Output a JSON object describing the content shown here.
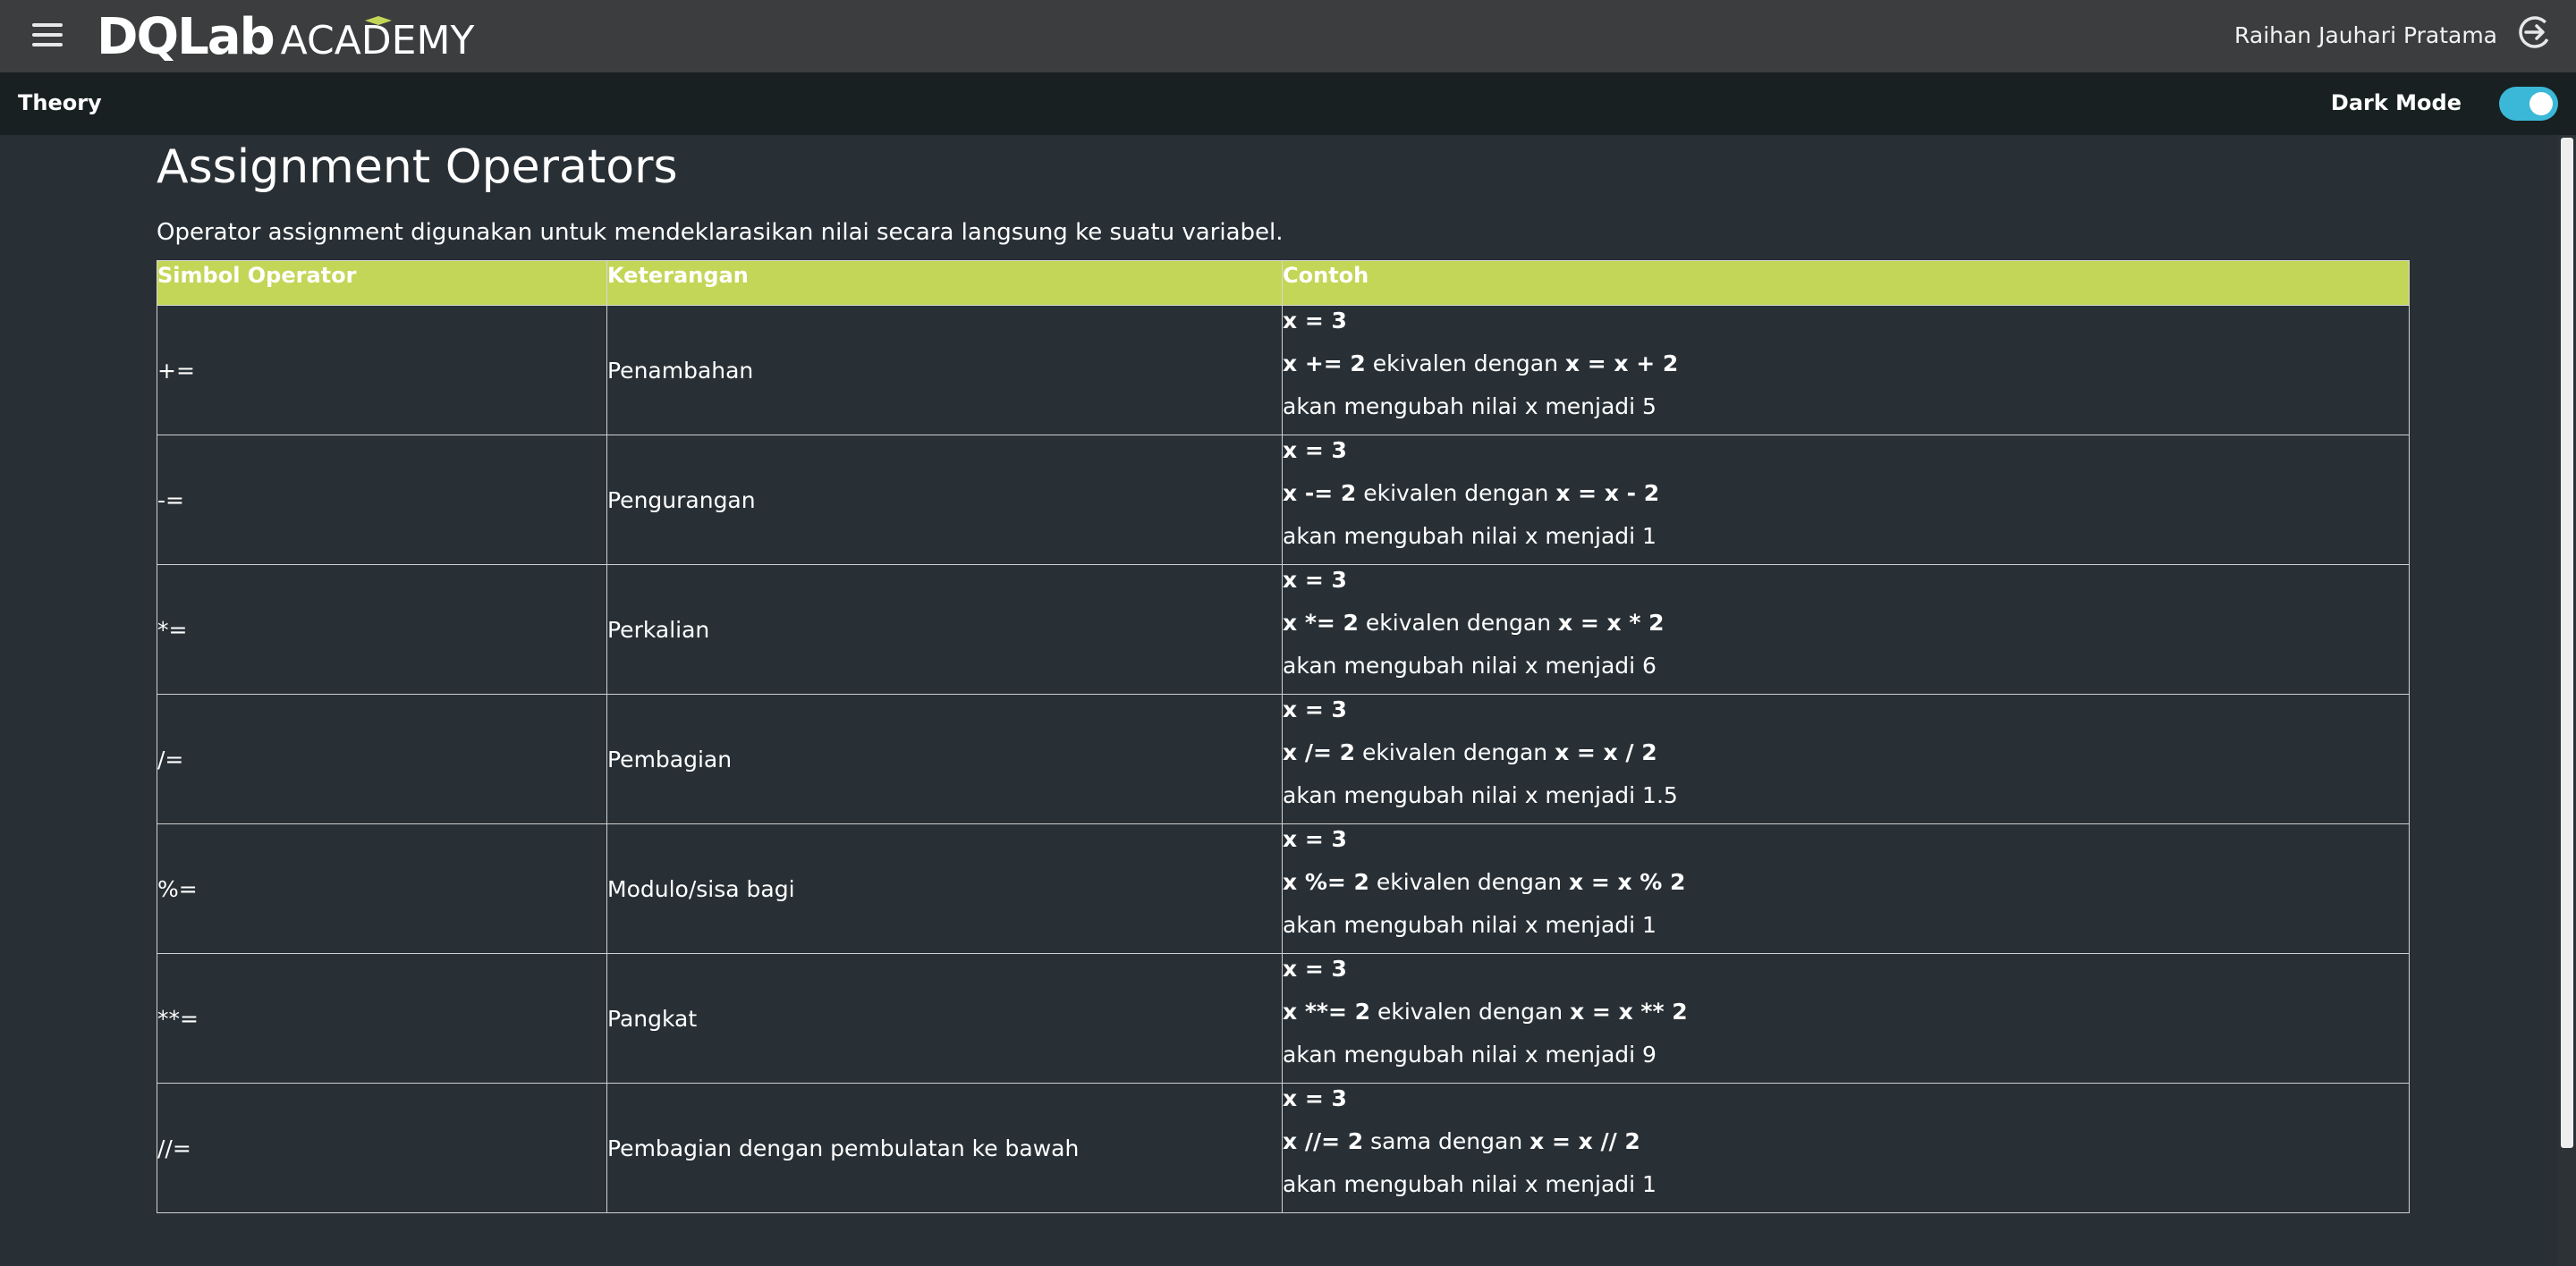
{
  "header": {
    "logo_main": "DQLab",
    "logo_sub": "ACADEMY",
    "user_name": "Raihan Jauhari Pratama"
  },
  "subbar": {
    "title": "Theory",
    "dark_mode_label": "Dark Mode",
    "dark_mode_on": true
  },
  "article": {
    "title": "Assignment Operators",
    "description": "Operator assignment digunakan untuk mendeklarasikan nilai secara langsung ke suatu variabel."
  },
  "table": {
    "headers": [
      "Simbol Operator",
      "Keterangan",
      "Contoh"
    ],
    "rows": [
      {
        "symbol": "+=",
        "desc": "Penambahan",
        "init": "x = 3",
        "op": "x += 2",
        "mid": " ekivalen dengan ",
        "eq": "x = x + 2",
        "result": "akan mengubah nilai x menjadi 5"
      },
      {
        "symbol": "-=",
        "desc": "Pengurangan",
        "init": "x = 3",
        "op": "x -= 2",
        "mid": " ekivalen dengan ",
        "eq": "x = x - 2",
        "result": "akan mengubah nilai x menjadi 1"
      },
      {
        "symbol": "*=",
        "desc": "Perkalian",
        "init": "x = 3",
        "op": "x *= 2",
        "mid": " ekivalen dengan ",
        "eq": "x = x * 2",
        "result": "akan mengubah nilai x menjadi 6"
      },
      {
        "symbol": "/=",
        "desc": "Pembagian",
        "init": "x = 3",
        "op": "x /= 2",
        "mid": " ekivalen dengan ",
        "eq": "x = x / 2",
        "result": "akan mengubah nilai x menjadi 1.5"
      },
      {
        "symbol": "%=",
        "desc": "Modulo/sisa bagi",
        "init": "x = 3",
        "op": "x %= 2",
        "mid": " ekivalen dengan ",
        "eq": "x = x % 2",
        "result": "akan mengubah nilai x menjadi 1"
      },
      {
        "symbol": "**=",
        "desc": "Pangkat",
        "init": "x = 3",
        "op": "x **= 2",
        "mid": " ekivalen dengan ",
        "eq": "x = x ** 2",
        "result": "akan mengubah nilai x menjadi 9"
      },
      {
        "symbol": "//=",
        "desc": "Pembagian dengan pembulatan ke bawah",
        "init": "x = 3",
        "op": "x //= 2",
        "mid": " sama dengan ",
        "eq": "x = x // 2",
        "result": "akan mengubah nilai x menjadi 1"
      }
    ]
  },
  "colors": {
    "topbar": "#3b3d3e",
    "subbar": "#182021",
    "background": "#283036",
    "table_header": "#c4d657",
    "toggle": "#3bb8d8"
  },
  "icons": {
    "menu": "hamburger-menu-icon",
    "logout": "logout-icon"
  }
}
